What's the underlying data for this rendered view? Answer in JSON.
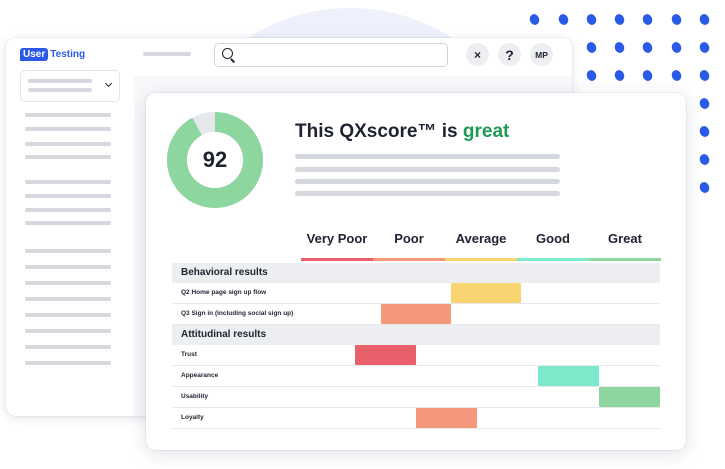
{
  "app": {
    "logo": {
      "user": "User",
      "testing": "Testing"
    },
    "search": {
      "value": "",
      "placeholder": ""
    },
    "header_buttons": {
      "close": "×",
      "help": "?",
      "avatar": "MP"
    }
  },
  "card": {
    "score": "92",
    "headline_prefix": "This QXscore™ is ",
    "headline_rating": "great",
    "scale": [
      "Very Poor",
      "Poor",
      "Average",
      "Good",
      "Great"
    ],
    "scale_colors": [
      "#e8606a",
      "#f5977a",
      "#f9d572",
      "#7de9cb",
      "#8dd69f"
    ],
    "sections": [
      {
        "title": "Behavioral results",
        "rows": [
          {
            "label": "Q2 Home page sign up flow",
            "level": "Average",
            "color": "#f9d572"
          },
          {
            "label": "Q3 Sign in (including social sign up)",
            "level": "Poor",
            "color": "#f5977a"
          }
        ]
      },
      {
        "title": "Attitudinal results",
        "rows": [
          {
            "label": "Trust",
            "level": "Very Poor",
            "color": "#e8606a"
          },
          {
            "label": "Appearance",
            "level": "Good",
            "color": "#7de9cb"
          },
          {
            "label": "Usability",
            "level": "Great",
            "color": "#8dd69f"
          },
          {
            "label": "Loyalty",
            "level": "Poor",
            "color": "#f5977a"
          }
        ]
      }
    ]
  },
  "colors": {
    "brand": "#2b59e8",
    "donut": "#8dd69f",
    "donut_track": "#e6e8ec",
    "great_text": "#1f9a55"
  }
}
